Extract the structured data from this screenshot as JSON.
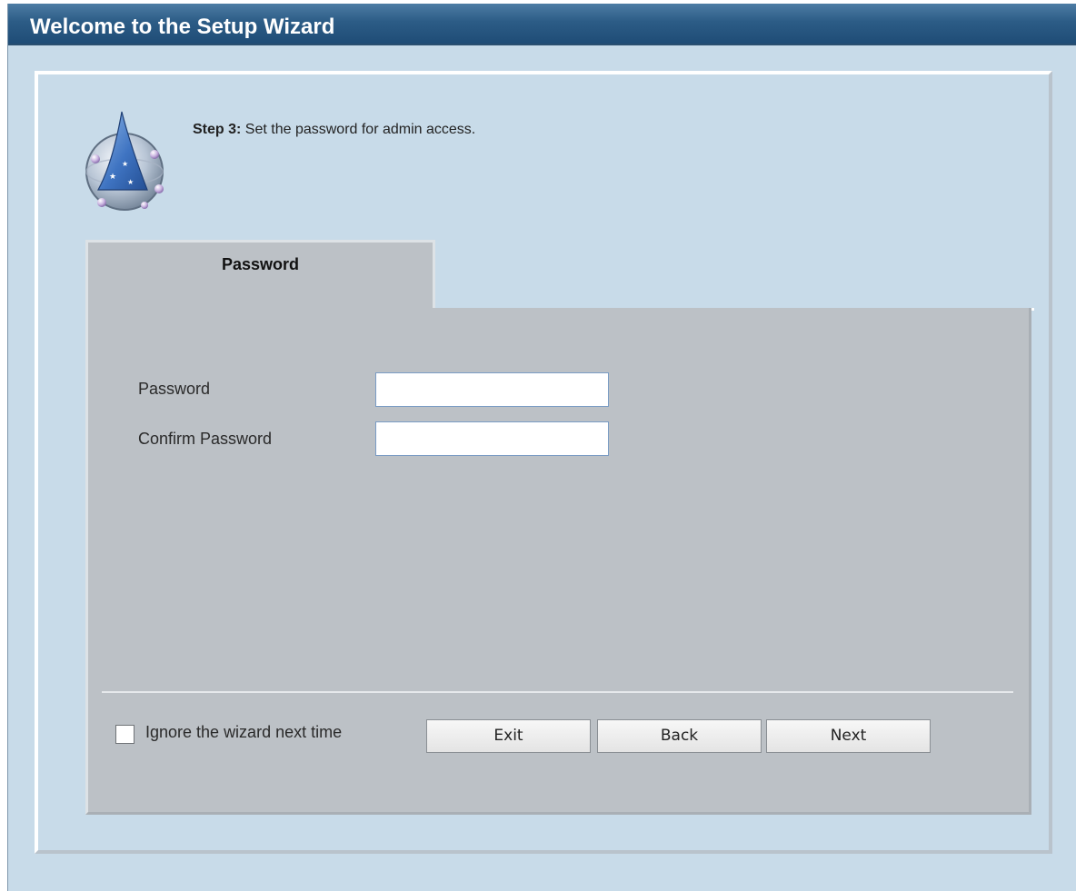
{
  "window": {
    "title": "Welcome to the Setup Wizard"
  },
  "step": {
    "prefix": "Step 3:",
    "text": " Set the password for admin access."
  },
  "tab": {
    "label": "Password"
  },
  "form": {
    "password_label": "Password",
    "password_value": "",
    "confirm_label": "Confirm Password",
    "confirm_value": ""
  },
  "footer": {
    "ignore_label": "Ignore the wizard next time",
    "ignore_checked": false,
    "exit_label": "Exit",
    "back_label": "Back",
    "next_label": "Next"
  },
  "icons": {
    "wizard": "wizard-hat-icon"
  },
  "colors": {
    "title_bar": "#2c5c86",
    "background": "#c8dbe9",
    "panel": "#bcc1c6",
    "input_border": "#7a9cc4"
  }
}
